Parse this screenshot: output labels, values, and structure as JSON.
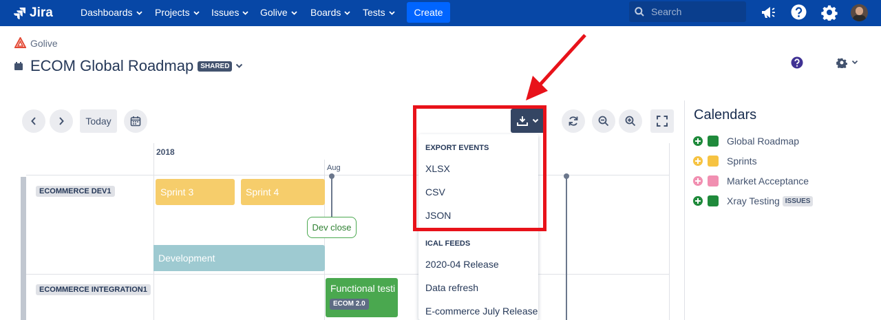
{
  "topnav": {
    "logo_text": "Jira",
    "items": [
      {
        "label": "Dashboards"
      },
      {
        "label": "Projects"
      },
      {
        "label": "Issues"
      },
      {
        "label": "Golive"
      },
      {
        "label": "Boards"
      },
      {
        "label": "Tests"
      }
    ],
    "create_label": "Create",
    "search_placeholder": "Search",
    "icons": [
      "notifications-icon",
      "help-icon",
      "settings-icon",
      "avatar"
    ]
  },
  "breadcrumb": {
    "project": "Golive"
  },
  "page": {
    "title": "ECOM Global Roadmap",
    "badge": "SHARED"
  },
  "toolbar": {
    "today_label": "Today"
  },
  "timeline": {
    "year": "2018",
    "month": "Aug",
    "lanes": [
      {
        "label": "ECOMMERCE DEV1"
      },
      {
        "label": "ECOMMERCE INTEGRATION1"
      }
    ],
    "events": {
      "sprint3": "Sprint 3",
      "sprint4": "Sprint 4",
      "dev_close": "Dev close",
      "development": "Development",
      "functional_testing": "Functional testi",
      "functional_badge": "ECOM 2.0"
    }
  },
  "export_menu": {
    "export_header": "EXPORT EVENTS",
    "formats": [
      "XLSX",
      "CSV",
      "JSON"
    ],
    "ical_header": "ICAL FEEDS",
    "feeds": [
      "2020-04 Release",
      "Data refresh",
      "E-commerce July Release"
    ]
  },
  "calendars": {
    "title": "Calendars",
    "items": [
      {
        "name": "Global Roadmap",
        "color": "#1f8a3b",
        "add_color": "#1f8a3b"
      },
      {
        "name": "Sprints",
        "color": "#f6c342",
        "add_color": "#f6c342"
      },
      {
        "name": "Market Acceptance",
        "color": "#f18fb1",
        "add_color": "#f18fb1"
      },
      {
        "name": "Xray Testing",
        "color": "#1f8a3b",
        "add_color": "#1f8a3b",
        "badge": "ISSUES"
      }
    ]
  },
  "colors": {
    "nav": "#0747a6",
    "annotation": "#e8121a",
    "sprint": "#f6cd6b",
    "development": "#9ecad1",
    "functional": "#4aa84f"
  }
}
